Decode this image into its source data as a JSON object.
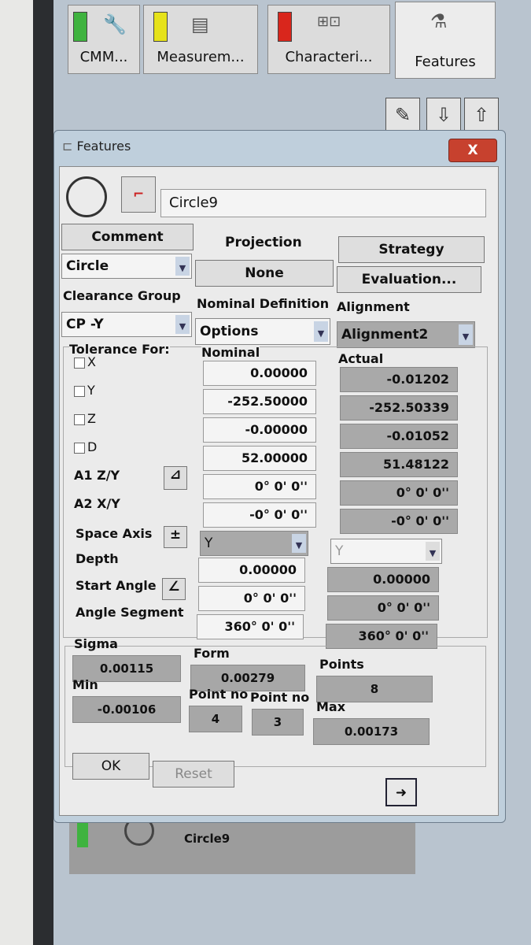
{
  "tabs": [
    {
      "label": "CMM...",
      "color": "#3fb33f",
      "icon": "wrench-icon"
    },
    {
      "label": "Measurem...",
      "color": "#e6e21a",
      "icon": "document-icon"
    },
    {
      "label": "Characteri...",
      "color": "#d9261c",
      "icon": "characteristic-icon"
    },
    {
      "label": "Features",
      "icon": "features-icon"
    }
  ],
  "toolbar": {
    "edit": "✎",
    "down": "⇩",
    "up": "⇧"
  },
  "dialog": {
    "title": "Features",
    "close": "X",
    "name": "Circle9",
    "comment": "Comment",
    "projection_label": "Projection",
    "projection_value": "None",
    "strategy": "Strategy",
    "evaluation": "Evaluation...",
    "feature_type": "Circle",
    "clearance_label": "Clearance Group",
    "clearance_value": "CP -Y",
    "nominal_def_label": "Nominal Definition",
    "nominal_def_value": "Options",
    "alignment_label": "Alignment",
    "alignment_value": "Alignment2",
    "tolerance_for": "Tolerance For:",
    "nominal_header": "Nominal",
    "actual_header": "Actual",
    "rows": [
      {
        "label": "X",
        "checkbox": true,
        "nominal": "0.00000",
        "actual": "-0.01202"
      },
      {
        "label": "Y",
        "checkbox": true,
        "nominal": "-252.50000",
        "actual": "-252.50339"
      },
      {
        "label": "Z",
        "checkbox": true,
        "nominal": "-0.00000",
        "actual": "-0.01052"
      },
      {
        "label": "D",
        "checkbox": true,
        "nominal": "52.00000",
        "actual": "51.48122"
      },
      {
        "label": "A1 Z/Y",
        "nominal": "0° 0' 0''",
        "actual": "0° 0' 0''"
      },
      {
        "label": "A2 X/Y",
        "nominal": "-0° 0' 0''",
        "actual": "-0° 0' 0''"
      }
    ],
    "space_axis_label": "Space Axis",
    "space_axis_nominal": "Y",
    "space_axis_actual": "Y",
    "pm": "±",
    "depth_label": "Depth",
    "depth_nominal": "0.00000",
    "depth_actual": "0.00000",
    "start_angle_label": "Start Angle",
    "start_angle_nominal": "0° 0' 0''",
    "start_angle_actual": "0° 0' 0''",
    "angle_segment_label": "Angle Segment",
    "angle_segment_nominal": "360° 0' 0''",
    "angle_segment_actual": "360° 0' 0''",
    "stats": {
      "sigma_label": "Sigma",
      "sigma": "0.00115",
      "form_label": "Form",
      "form": "0.00279",
      "points_label": "Points",
      "points": "8",
      "min_label": "Min",
      "min": "-0.00106",
      "pointno_label": "Point no",
      "min_point": "4",
      "max_point": "3",
      "max_label": "Max",
      "max": "0.00173"
    },
    "ok": "OK",
    "reset": "Reset",
    "next": "➜"
  },
  "list": {
    "item": "Circle9"
  }
}
